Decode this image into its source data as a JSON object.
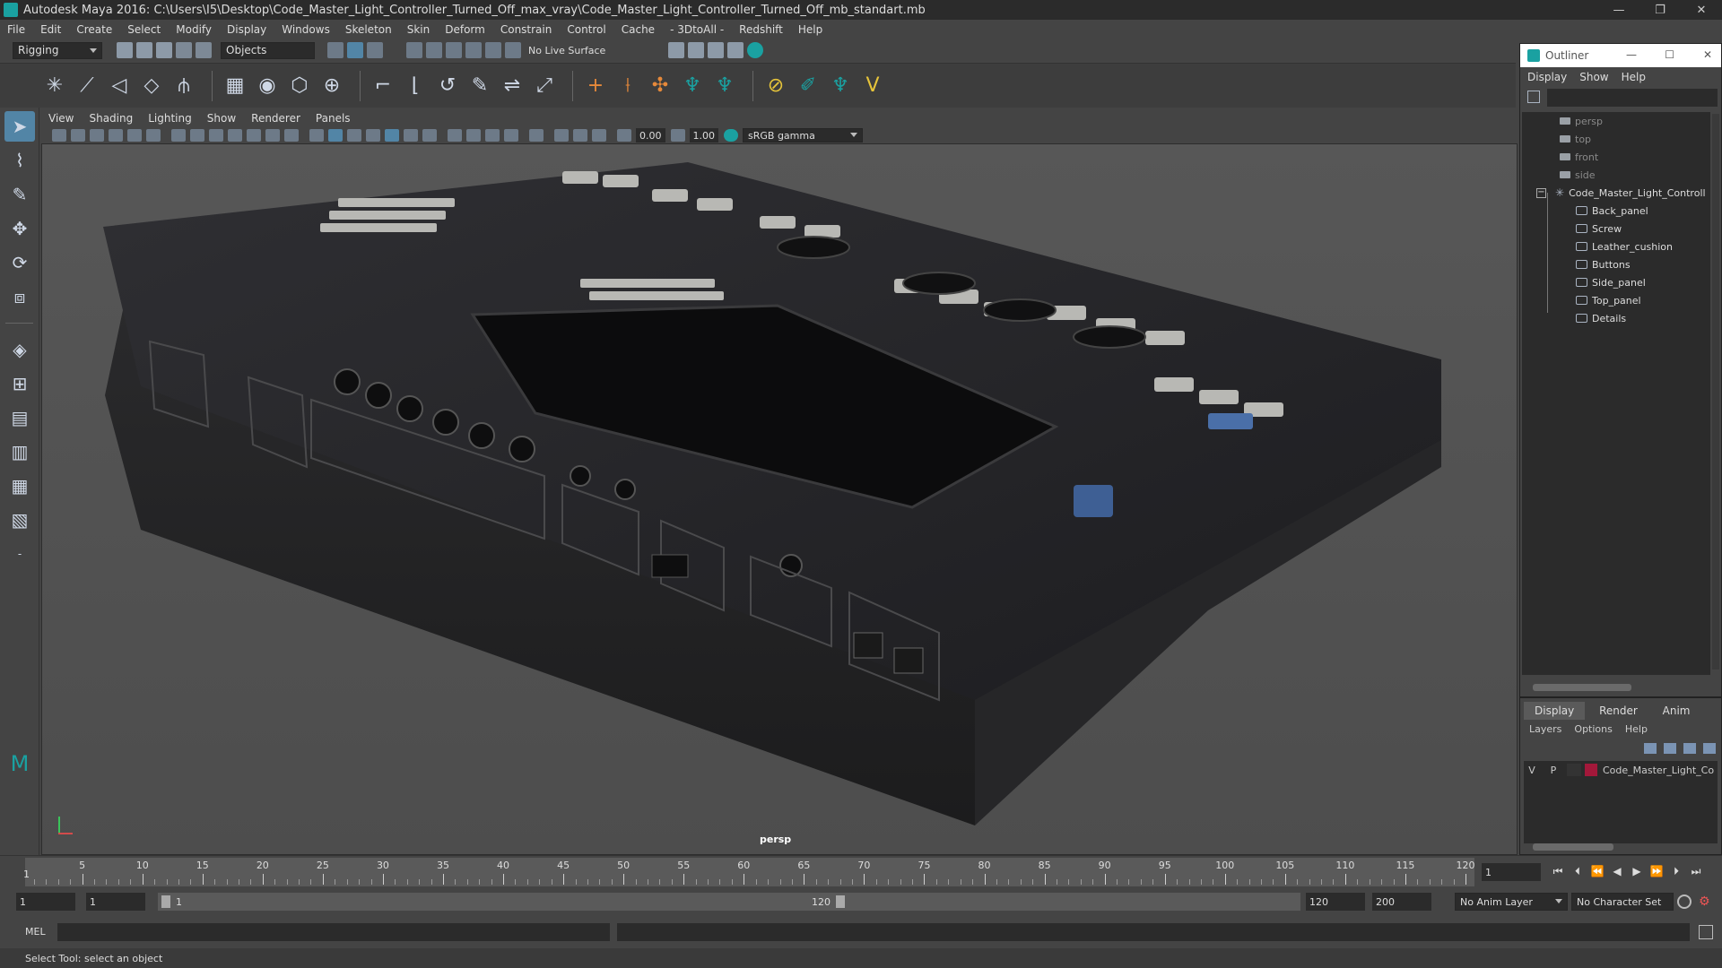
{
  "window": {
    "title": "Autodesk Maya 2016: C:\\Users\\I5\\Desktop\\Code_Master_Light_Controller_Turned_Off_max_vray\\Code_Master_Light_Controller_Turned_Off_mb_standart.mb",
    "minimize": "—",
    "restore": "❐",
    "close": "✕"
  },
  "menubar": [
    "File",
    "Edit",
    "Create",
    "Select",
    "Modify",
    "Display",
    "Windows",
    "Skeleton",
    "Skin",
    "Deform",
    "Constrain",
    "Control",
    "Cache",
    "- 3DtoAll -",
    "Redshift",
    "Help"
  ],
  "statusline": {
    "mode": "Rigging",
    "selection_mode": "Objects",
    "live_surface": "No Live Surface"
  },
  "viewport": {
    "menu": [
      "View",
      "Shading",
      "Lighting",
      "Show",
      "Renderer",
      "Panels"
    ],
    "exposure": "0.00",
    "gamma": "1.00",
    "color_space": "sRGB gamma",
    "camera": "persp"
  },
  "outliner": {
    "title": "Outliner",
    "minimize": "—",
    "maximize": "☐",
    "close": "✕",
    "menu": [
      "Display",
      "Show",
      "Help"
    ],
    "cameras": [
      "persp",
      "top",
      "front",
      "side"
    ],
    "root": "Code_Master_Light_Controll",
    "children": [
      "Back_panel",
      "Screw",
      "Leather_cushion",
      "Buttons",
      "Side_panel",
      "Top_panel",
      "Details"
    ]
  },
  "layers": {
    "tabs": [
      "Display",
      "Render",
      "Anim"
    ],
    "menu": [
      "Layers",
      "Options",
      "Help"
    ],
    "layer_visible": "V",
    "layer_playback": "P",
    "layer_name": "Code_Master_Light_Co",
    "layer_color": "#a3183a"
  },
  "timeline": {
    "labels": [
      "5",
      "10",
      "15",
      "20",
      "25",
      "30",
      "35",
      "40",
      "45",
      "50",
      "55",
      "60",
      "65",
      "70",
      "75",
      "80",
      "85",
      "90",
      "95",
      "100",
      "105",
      "110",
      "115",
      "120"
    ],
    "start_label": "1",
    "current_frame": "1"
  },
  "range": {
    "start": "1",
    "playback_start": "1",
    "range_start": "1",
    "range_end": "120",
    "playback_end": "120",
    "end": "200",
    "anim_layer": "No Anim Layer",
    "character_set": "No Character Set"
  },
  "command": {
    "label": "MEL"
  },
  "helpline": {
    "text": "Select Tool: select an object"
  },
  "colors": {
    "accent": "#5285a6",
    "panel": "#444444",
    "field": "#2b2b2b"
  }
}
